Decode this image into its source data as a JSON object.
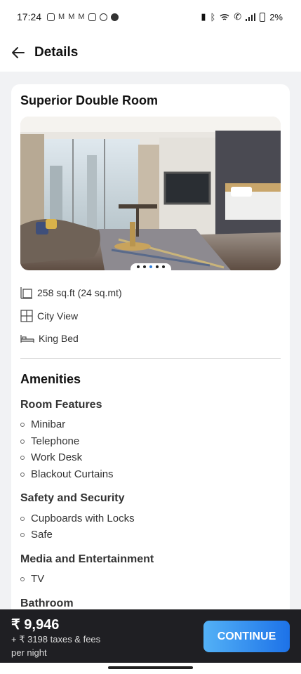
{
  "status_bar": {
    "time": "17:24",
    "battery": "2%",
    "notification_icons": [
      "gmail-icon",
      "gmail-icon",
      "gmail-icon",
      "gmail-icon",
      "instagram-icon",
      "chrome-icon",
      "whatsapp-icon"
    ],
    "system_icons": [
      "vibrate-icon",
      "bluetooth-icon",
      "wifi-icon",
      "wifi-call-icon",
      "signal-icon",
      "battery-icon"
    ]
  },
  "header": {
    "title": "Details",
    "back_icon": "arrow-left-icon"
  },
  "room": {
    "name": "Superior Double Room",
    "gallery": {
      "image_count": 5,
      "active_index": 2
    },
    "features": [
      {
        "icon": "area-icon",
        "label": "258 sq.ft (24 sq.mt)"
      },
      {
        "icon": "window-view-icon",
        "label": "City View"
      },
      {
        "icon": "bed-icon",
        "label": "King Bed"
      }
    ]
  },
  "amenities": {
    "title": "Amenities",
    "groups": [
      {
        "title": "Room Features",
        "items": [
          "Minibar",
          "Telephone",
          "Work Desk",
          "Blackout Curtains"
        ]
      },
      {
        "title": "Safety and Security",
        "items": [
          "Cupboards with Locks",
          "Safe"
        ]
      },
      {
        "title": "Media and Entertainment",
        "items": [
          "TV"
        ]
      },
      {
        "title": "Bathroom",
        "items": []
      }
    ]
  },
  "footer": {
    "price": "₹ 9,946",
    "taxes": "+ ₹ 3198 taxes & fees",
    "per_night": "per night",
    "cta_label": "CONTINUE"
  },
  "colors": {
    "accent": "#2f7ddb",
    "cta_gradient_start": "#53b1f6",
    "cta_gradient_end": "#1d72e8",
    "footer_bg": "#1f1f23",
    "page_bg": "#f1f2f4"
  }
}
